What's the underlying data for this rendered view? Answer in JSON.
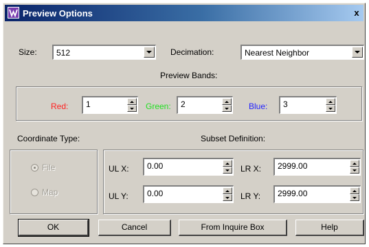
{
  "window": {
    "title": "Preview Options",
    "close_glyph": "x"
  },
  "size": {
    "label": "Size:",
    "value": "512"
  },
  "decimation": {
    "label": "Decimation:",
    "value": "Nearest Neighbor"
  },
  "bands": {
    "heading": "Preview Bands:",
    "red": {
      "label": "Red:",
      "value": "1",
      "color": "#ff2020"
    },
    "green": {
      "label": "Green:",
      "value": "2",
      "color": "#20e020"
    },
    "blue": {
      "label": "Blue:",
      "value": "3",
      "color": "#2020ff"
    }
  },
  "coordinate_type": {
    "label": "Coordinate Type:",
    "options": [
      {
        "label": "File",
        "selected": true
      },
      {
        "label": "Map",
        "selected": false
      }
    ]
  },
  "subset": {
    "label": "Subset Definition:",
    "ulx": {
      "label": "UL X:",
      "value": "0.00"
    },
    "uly": {
      "label": "UL Y:",
      "value": "0.00"
    },
    "lrx": {
      "label": "LR X:",
      "value": "2999.00"
    },
    "lry": {
      "label": "LR Y:",
      "value": "2999.00"
    }
  },
  "buttons": {
    "ok": "OK",
    "cancel": "Cancel",
    "from_inquire": "From Inquire Box",
    "help": "Help"
  }
}
